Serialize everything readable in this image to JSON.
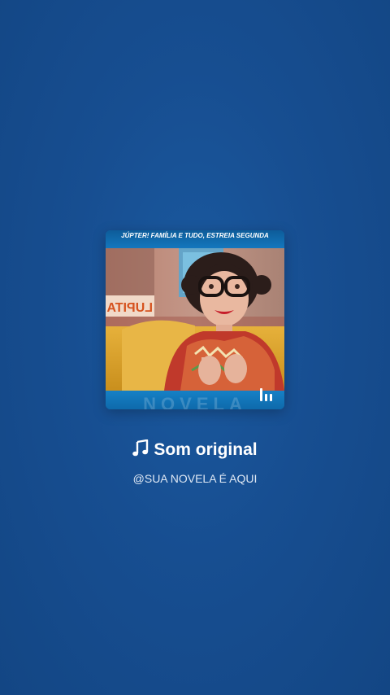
{
  "card": {
    "caption": "JÚPTER! FAMÍLIA E TUDO, ESTREIA SEGUNDA",
    "thumbnail_sign": "LUPITA",
    "footer_faint_text": "NOVELA",
    "playing_icon": "audio-playing-bars-icon"
  },
  "sound": {
    "icon": "music-note-icon",
    "title": "Som original",
    "author": "@SUA NOVELA É AQUI"
  },
  "colors": {
    "background": "#174e91",
    "card_frame": "#0f6fb3",
    "text": "#ffffff"
  }
}
